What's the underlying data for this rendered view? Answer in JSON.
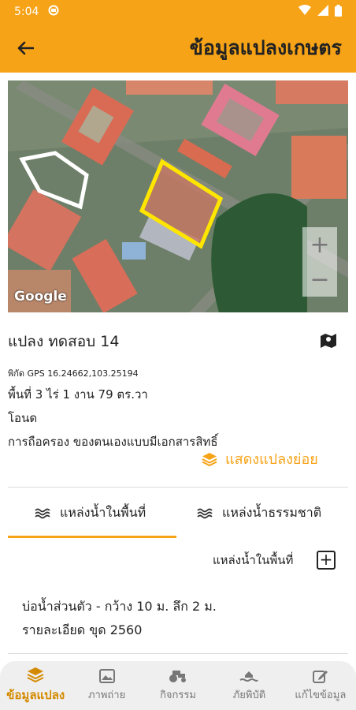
{
  "status_bar": {
    "time": "5:04"
  },
  "app_bar": {
    "title": "ข้อมูลแปลงเกษตร"
  },
  "map": {
    "attribution": "Google",
    "zoom_in": "+",
    "zoom_out": "−"
  },
  "plot": {
    "name": "แปลง ทดสอบ 14",
    "gps": "พิกัด GPS 16.24662,103.25194",
    "area": "พื้นที่ 3 ไร่ 1 งาน 79 ตร.วา",
    "deed": "โอนด",
    "ownership": "การถือครอง ของตนเองแบบมีเอกสารสิทธิ์"
  },
  "show_subplots": "แสดงแปลงย่อย",
  "tabs": [
    {
      "label": "แหล่งน้ำในพื้นที่"
    },
    {
      "label": "แหล่งน้ำธรรมชาติ"
    }
  ],
  "section": {
    "label": "แหล่งน้ำในพื้นที่",
    "add": "+"
  },
  "water_item": {
    "line1": "บ่อน้ำส่วนตัว - กว้าง 10 ม. ลึก 2 ม.",
    "line2": "รายละเอียด ขุด 2560"
  },
  "bottom_nav": [
    {
      "label": "ข้อมูลแปลง"
    },
    {
      "label": "ภาพถ่าย"
    },
    {
      "label": "กิจกรรม"
    },
    {
      "label": "ภัยพิบัติ"
    },
    {
      "label": "แก้ไขข้อมูล"
    }
  ],
  "colors": {
    "accent": "#f6a317",
    "plot_outline": "#ffe600"
  }
}
